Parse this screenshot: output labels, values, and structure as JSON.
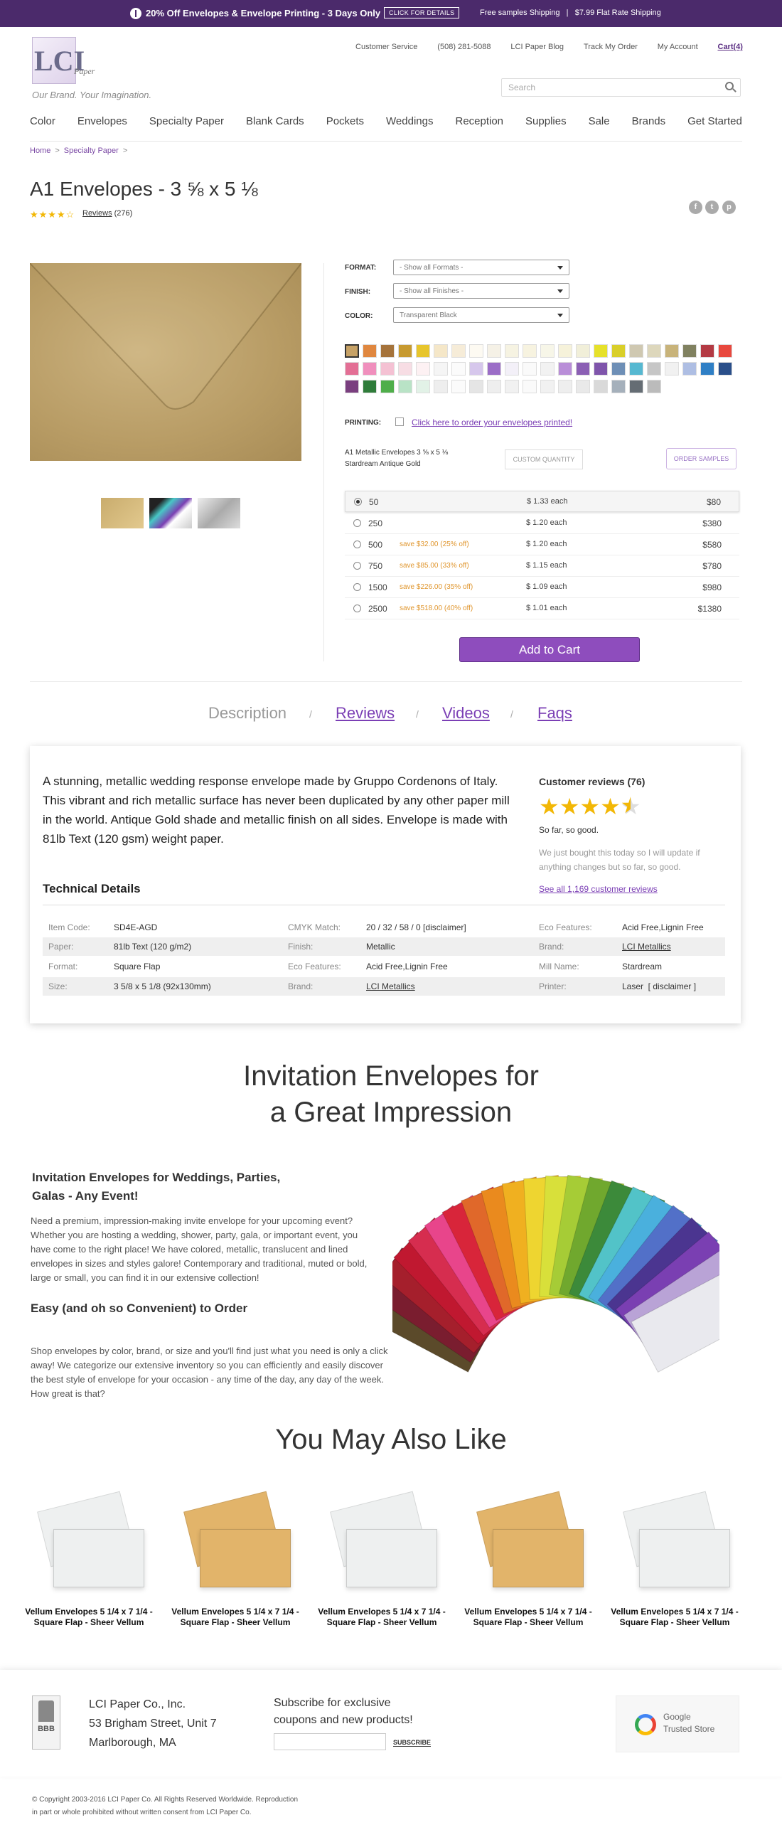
{
  "promo": {
    "text": "20% Off Envelopes & Envelope Printing - 3 Days Only",
    "button": "CLICK FOR DETAILS",
    "shipping": "Free samples Shipping   |   $7.99 Flat Rate Shipping"
  },
  "header": {
    "logo": "LCI",
    "logo_sub": "Paper",
    "tagline": "Our Brand. Your Imagination.",
    "links": [
      "Customer Service",
      "(508) 281-5088",
      "LCI Paper Blog",
      "Track My Order",
      "My Account",
      "Cart(4)"
    ],
    "search_placeholder": "Search",
    "nav": [
      "Color",
      "Envelopes",
      "Specialty Paper",
      "Blank Cards",
      "Pockets",
      "Weddings",
      "Reception",
      "Supplies",
      "Sale",
      "Brands",
      "Get Started"
    ]
  },
  "breadcrumb": [
    "Home",
    "Specialty Paper"
  ],
  "product": {
    "title": "A1 Envelopes - 3 ⅝ x 5 ⅛",
    "rating_stars": "★★★★☆",
    "rating": 4,
    "reviews": "Reviews",
    "review_count": "(276)",
    "format_label": "FORMAT:",
    "format_value": "- Show all Formats -",
    "finish_label": "FINISH:",
    "finish_value": "- Show all Finishes -",
    "color_label": "COLOR:",
    "color_value": "Transparent Black",
    "printing_label": "PRINTING:",
    "printing_link": "Click here to order your envelopes printed!",
    "name_line1": "A1 Metallic Envelopes 3 ⅝ x 5 ⅛",
    "name_line2": "Stardream Antique Gold",
    "custom_quantity": "CUSTOM QUANTITY",
    "order_samples": "ORDER SAMPLES",
    "add_to_cart": "Add to Cart",
    "pricing": [
      {
        "qty": "50",
        "save": "",
        "each": "$ 1.33 each",
        "total": "$80"
      },
      {
        "qty": "250",
        "save": "",
        "each": "$ 1.20 each",
        "total": "$380"
      },
      {
        "qty": "500",
        "save": "save $32.00 (25% off)",
        "each": "$ 1.20 each",
        "total": "$580"
      },
      {
        "qty": "750",
        "save": "save $85.00 (33% off)",
        "each": "$ 1.15 each",
        "total": "$780"
      },
      {
        "qty": "1500",
        "save": "save $226.00 (35% off)",
        "each": "$ 1.09 each",
        "total": "$980"
      },
      {
        "qty": "2500",
        "save": "save $518.00 (40% off)",
        "each": "$ 1.01 each",
        "total": "$1380"
      }
    ],
    "swatches": [
      [
        "#c7a266",
        "#e0873f",
        "#a5733b",
        "#c79a30",
        "#e7c52c",
        "#f5e7c8",
        "#f6ecd8",
        "#fdfaf2",
        "#f5f1e6",
        "#f6f3e2",
        "#f7f3e0",
        "#f7f6e8",
        "#f6f2da",
        "#f1efd9",
        "#e6e12a",
        "#d9cf2a",
        "#cfc8b1",
        "#ddd7bc",
        "#c8b37a",
        "#808160",
        "#b33a43",
        "#e8483e"
      ],
      [
        "#e36f95",
        "#f08fbd",
        "#f4c1d3",
        "#f7dde4",
        "#fdf1f3",
        "#f5f5f5",
        "#fbfbfb",
        "#d6c7ec",
        "#9b6dc7",
        "#f3f0f8",
        "#fafafa",
        "#f2f2f2",
        "#b98ed8",
        "#8b5fb4",
        "#7f55ab",
        "#6e8fb6",
        "#56b8d1",
        "#c6c6c6",
        "#f1f1f1",
        "#aebee3",
        "#2f7fc5",
        "#2a4f8a"
      ],
      [
        "#7a3f7f",
        "#2f7c3a",
        "#4fae4a",
        "#b9e3c6",
        "#e2f2e7",
        "#eeeeee",
        "#fbfbfb",
        "#e5e5e5",
        "#eeeeee",
        "#f1f1f1",
        "#fafafa",
        "#f1f1f1",
        "#eeeeee",
        "#e9e9e9",
        "#d9d9d9",
        "#a5b0bb",
        "#656d74",
        "#bbbbbb"
      ]
    ]
  },
  "tabs": [
    "Description",
    "Reviews",
    "Videos",
    "Faqs"
  ],
  "description": "A stunning, metallic wedding response envelope made by Gruppo Cordenons of Italy. This vibrant and rich metallic surface has never been duplicated by any other paper mill in the world. Antique Gold shade and metallic finish on all sides. Envelope is made with 81lb Text (120 gsm) weight paper.",
  "technical_heading": "Technical Details",
  "technical": [
    [
      [
        "Item Code:",
        "SD4E-AGD"
      ],
      [
        "CMYK Match:",
        "20 / 32 / 58 / 0 [disclaimer]"
      ],
      [
        "Eco Features:",
        "Acid Free,Lignin Free"
      ]
    ],
    [
      [
        "Paper:",
        "81lb Text (120 g/m2)"
      ],
      [
        "Finish:",
        "Metallic"
      ],
      [
        "Brand:",
        "LCI Metallics"
      ]
    ],
    [
      [
        "Format:",
        "Square Flap"
      ],
      [
        "Eco Features:",
        "Acid Free,Lignin Free"
      ],
      [
        "Mill Name:",
        "Stardream"
      ]
    ],
    [
      [
        "Size:",
        "3 5/8 x 5 1/8 (92x130mm)"
      ],
      [
        "Brand:",
        "LCI Metallics"
      ],
      [
        "Printer:",
        "Laser  [ disclaimer ]"
      ]
    ]
  ],
  "customer_reviews": {
    "heading": "Customer reviews (76)",
    "rating": 3.5,
    "stars": "★★★★",
    "title": "So far, so good.",
    "text": "We just bought this today so I will update if anything changes but so far, so good.",
    "see_all": "See all 1,169 customer reviews"
  },
  "invitation": {
    "heading_line1": "Invitation Envelopes for",
    "heading_line2": "a Great Impression",
    "sub1_line1": "Invitation Envelopes for Weddings, Parties,",
    "sub1_line2": "Galas - Any Event!",
    "para1": "Need a premium, impression-making invite envelope for your upcoming event? Whether you are hosting a wedding, shower, party, gala, or important event, you have come to the right place! We have colored, metallic, translucent and lined envelopes in sizes and styles galore! Contemporary and traditional, muted or bold, large or small, you can find it in our extensive collection!",
    "sub2": "Easy (and oh so Convenient) to Order",
    "para2": "Shop envelopes by color, brand, or size and you'll find just what you need is only a click away! We categorize our extensive inventory so you can efficiently and easily discover the best style of envelope for your occasion - any time of the day, any day of the week. How great is that?",
    "fan_colors": [
      "#5b4a2a",
      "#7a1d2f",
      "#a51f2c",
      "#c01830",
      "#d62d4f",
      "#e8458b",
      "#d8253a",
      "#e0682a",
      "#ea8a1e",
      "#f0b020",
      "#eed530",
      "#d8e03a",
      "#a6cc36",
      "#70a82e",
      "#3c8a3a",
      "#52c3c8",
      "#4ab0dd",
      "#5270c8",
      "#4b3590",
      "#7a3fb2",
      "#b9a3d6",
      "#e9e9ee"
    ]
  },
  "ymal": {
    "heading": "You May Also Like",
    "items": [
      {
        "name": "Vellum Envelopes 5 1/4 x 7 1/4 - Square Flap - Sheer Vellum",
        "color": "#eef0f0"
      },
      {
        "name": "Vellum Envelopes 5 1/4 x 7 1/4 - Square Flap - Sheer Vellum",
        "color": "#e2b46a"
      },
      {
        "name": "Vellum Envelopes 5 1/4 x 7 1/4 - Square Flap - Sheer Vellum",
        "color": "#eef0f0"
      },
      {
        "name": "Vellum Envelopes 5 1/4 x 7 1/4 - Square Flap - Sheer Vellum",
        "color": "#e2b46a"
      },
      {
        "name": "Vellum Envelopes 5 1/4 x 7 1/4 - Square Flap - Sheer Vellum",
        "color": "#eef0f0"
      }
    ]
  },
  "footer": {
    "company": "LCI Paper Co., Inc.",
    "street": "53 Brigham Street, Unit 7",
    "city": "Marlborough, MA",
    "subscribe_line1": "Subscribe for exclusive",
    "subscribe_line2": "coupons and new products!",
    "subscribe_button": "SUBSCRIBE",
    "google_line1": "Google",
    "google_line2": "Trusted Store",
    "bbb": "BBB",
    "copyright_line1": "© Copyright 2003-2016 LCI Paper Co. All Rights Reserved Worldwide. Reproduction",
    "copyright_line2": "in part or whole prohibited without written consent from LCI Paper Co."
  },
  "colors": {
    "brand_purple": "#5a2d82",
    "promo_bg": "#4b2a6b",
    "add_to_cart": "#8e4dbd",
    "star": "#f2b705",
    "save_orange": "#e0962e"
  }
}
